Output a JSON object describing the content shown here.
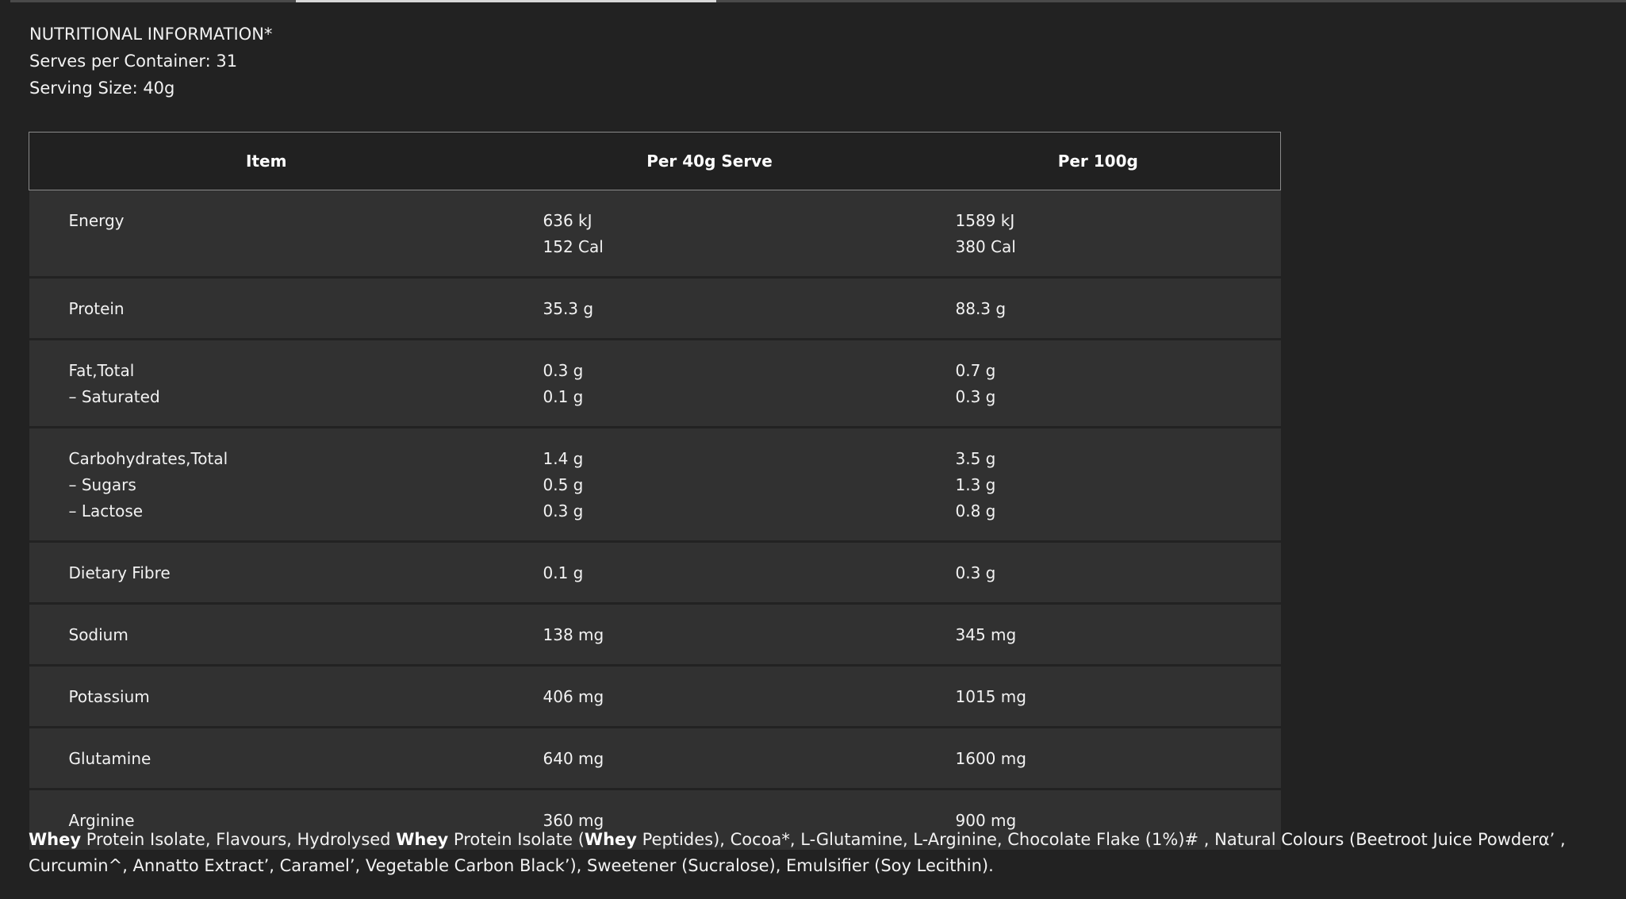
{
  "intro": {
    "title": "NUTRITIONAL INFORMATION*",
    "serves": "Serves per Container: 31",
    "serving_size": "Serving Size: 40g"
  },
  "table": {
    "headers": [
      "Item",
      "Per 40g Serve",
      "Per 100g"
    ],
    "rows": [
      {
        "item": [
          "Energy"
        ],
        "serve": [
          "636 kJ",
          "152 Cal"
        ],
        "per100": [
          "1589 kJ",
          "380 Cal"
        ]
      },
      {
        "item": [
          "Protein"
        ],
        "serve": [
          "35.3 g"
        ],
        "per100": [
          "88.3 g"
        ]
      },
      {
        "item": [
          "Fat,Total",
          "– Saturated"
        ],
        "serve": [
          "0.3 g",
          "0.1 g"
        ],
        "per100": [
          "0.7 g",
          "0.3 g"
        ]
      },
      {
        "item": [
          "Carbohydrates,Total",
          "– Sugars",
          "– Lactose"
        ],
        "serve": [
          "1.4 g",
          "0.5 g",
          "0.3 g"
        ],
        "per100": [
          "3.5 g",
          "1.3 g",
          "0.8 g"
        ]
      },
      {
        "item": [
          "Dietary Fibre"
        ],
        "serve": [
          "0.1 g"
        ],
        "per100": [
          "0.3 g"
        ]
      },
      {
        "item": [
          "Sodium"
        ],
        "serve": [
          "138 mg"
        ],
        "per100": [
          "345 mg"
        ]
      },
      {
        "item": [
          "Potassium"
        ],
        "serve": [
          "406 mg"
        ],
        "per100": [
          "1015 mg"
        ]
      },
      {
        "item": [
          "Glutamine"
        ],
        "serve": [
          "640 mg"
        ],
        "per100": [
          "1600 mg"
        ]
      },
      {
        "item": [
          "Arginine"
        ],
        "serve": [
          "360 mg"
        ],
        "per100": [
          "900 mg"
        ]
      }
    ]
  },
  "ingredients": {
    "segments": [
      {
        "text": "Whey",
        "bold": true
      },
      {
        "text": " Protein Isolate, Flavours, Hydrolysed ",
        "bold": false
      },
      {
        "text": "Whey",
        "bold": true
      },
      {
        "text": " Protein Isolate (",
        "bold": false
      },
      {
        "text": "Whey",
        "bold": true
      },
      {
        "text": " Peptides), Cocoa*, L-Glutamine, L-Arginine, Chocolate Flake (1%)# , Natural Colours (Beetroot Juice Powderα’ , Curcumin^, Annatto Extract’, Caramel’, Vegetable Carbon Black’), Sweetener (Sucralose), Emulsifier (Soy Lecithin).",
        "bold": false
      }
    ]
  }
}
